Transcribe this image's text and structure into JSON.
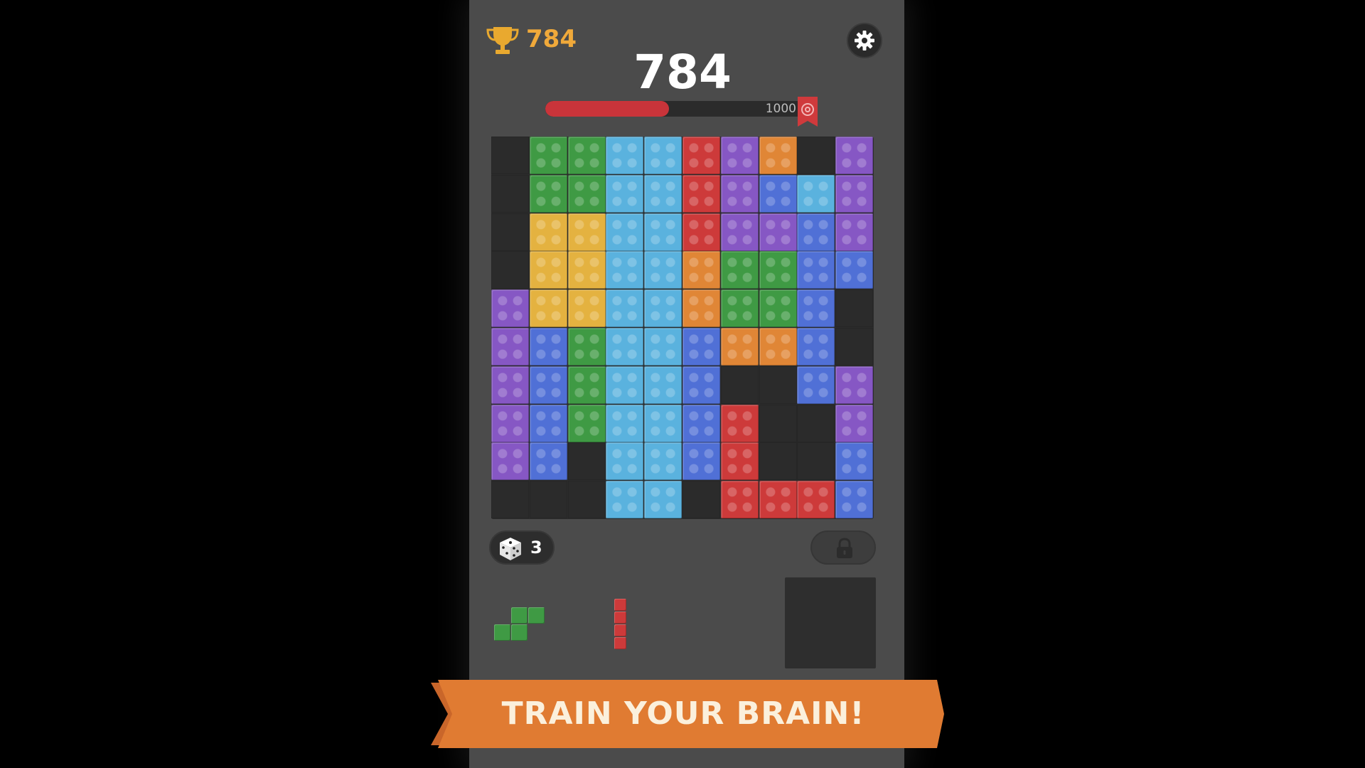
{
  "header": {
    "best_score": "784",
    "best_icon": "trophy-icon",
    "settings_icon": "gear-icon",
    "current_score": "784"
  },
  "progress": {
    "target_label": "1000",
    "current": 784,
    "target": 1000,
    "fill_fraction": 0.46,
    "goal_icon": "target-flag-icon"
  },
  "colors": {
    "G": "#3f9a44",
    "C": "#5ab2de",
    "R": "#cd3a3a",
    "P": "#8657c4",
    "O": "#e08636",
    "B": "#5070d6",
    "Y": "#e4b240",
    "empty": "#2b2b2b",
    "accent": "#f0a93a",
    "banner": "#e07b32"
  },
  "board": {
    "rows": 10,
    "cols": 10,
    "grid": [
      ".GGCCRPO.P",
      ".GGCCRPBCP",
      ".YYCCRPPBP",
      ".YYCCOGGBB",
      "PYYCCOGGB.",
      "PBGCCBOOB.",
      "PBGCCB..BP",
      "PBGCCBR..P",
      "PB.CCBR..B",
      "...CC.RRRB"
    ]
  },
  "powerups": {
    "dice_icon": "dice-icon",
    "dice_count": "3",
    "lock_icon": "lock-icon"
  },
  "tray": {
    "pieces": [
      {
        "name": "green-s-piece",
        "color": "G",
        "shape": [
          ".##",
          "##."
        ]
      },
      {
        "name": "red-i-piece",
        "color": "R",
        "shape": [
          "#",
          "#",
          "#",
          "#"
        ]
      }
    ],
    "hold_slot": "empty"
  },
  "banner": {
    "text": "TRAIN YOUR BRAIN!"
  }
}
